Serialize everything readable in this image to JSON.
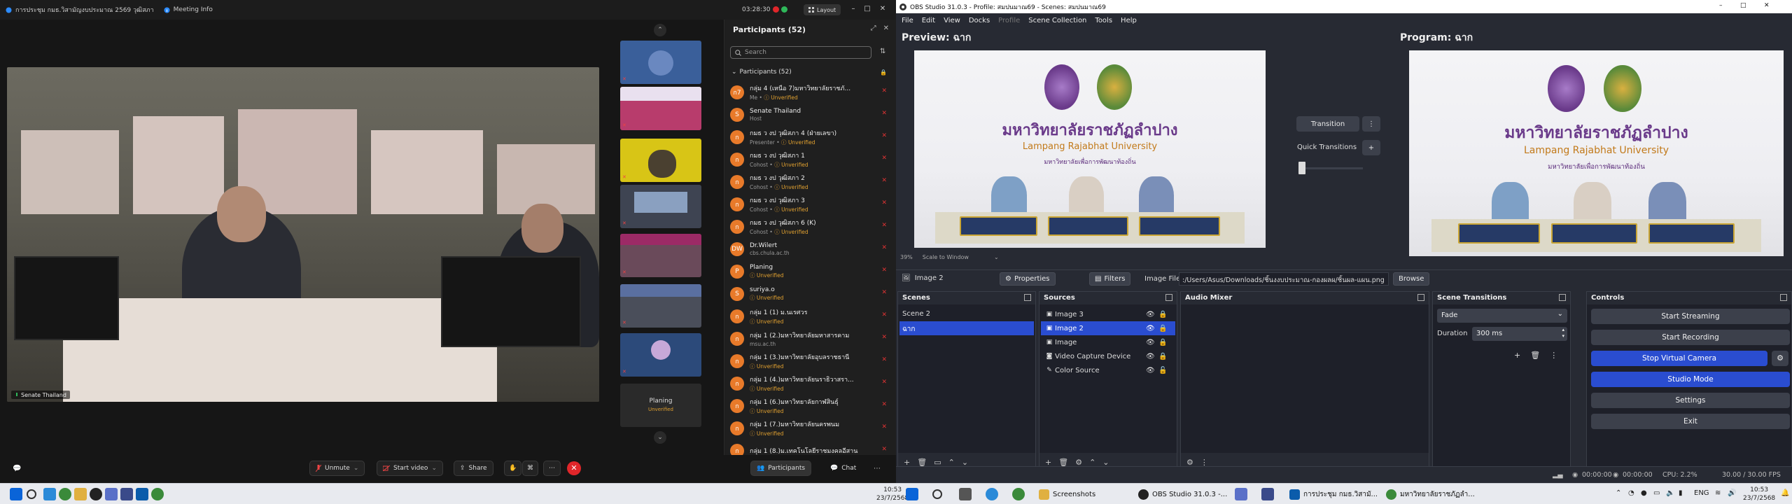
{
  "zoom": {
    "meeting_name": "การประชุม กมธ.วิสามัญงบประมาณ 2569 วุฒิสภา",
    "meeting_info_label": "Meeting Info",
    "timer": "03:28:30",
    "layout_label": "Layout",
    "speaker_name": "Senate Thailand",
    "gallery_tile_name": "Planing",
    "gallery_tile_status": "Unverified",
    "participants_panel": {
      "title": "Participants (52)",
      "search_placeholder": "Search",
      "group_label": "Participants (52)",
      "list": [
        {
          "avatar": "ก7",
          "name": "กลุ่ม 4 (เหนือ 7)มหาวิทยาลัยราชภั...",
          "role": "Me",
          "status": "Unverified"
        },
        {
          "avatar": "S",
          "name": "Senate Thailand",
          "role": "Host",
          "status": ""
        },
        {
          "avatar": "ก",
          "name": "กมธ ว งป วุฒิสภา 4 (ฝ่ายเลขา)",
          "role": "Presenter",
          "status": "Unverified"
        },
        {
          "avatar": "ก",
          "name": "กมธ ว งป วุฒิสภา 1",
          "role": "Cohost",
          "status": "Unverified"
        },
        {
          "avatar": "ก",
          "name": "กมธ ว งป วุฒิสภา 2",
          "role": "Cohost",
          "status": "Unverified"
        },
        {
          "avatar": "ก",
          "name": "กมธ ว งป วุฒิสภา 3",
          "role": "Cohost",
          "status": "Unverified"
        },
        {
          "avatar": "ก",
          "name": "กมธ ว งป วุฒิสภา 6 (K)",
          "role": "Cohost",
          "status": "Unverified"
        },
        {
          "avatar": "DW",
          "name": "Dr.Wilert",
          "role": "cbs.chula.ac.th",
          "status": ""
        },
        {
          "avatar": "P",
          "name": "Planing",
          "role": "",
          "status": "Unverified"
        },
        {
          "avatar": "S",
          "name": "suriya.o",
          "role": "",
          "status": "Unverified"
        },
        {
          "avatar": "ก",
          "name": "กลุ่ม 1 (1) ม.นเรศวร",
          "role": "",
          "status": "Unverified"
        },
        {
          "avatar": "ก",
          "name": "กลุ่ม 1 (2.)มหาวิทยาลัยมหาสารคาม",
          "role": "msu.ac.th",
          "status": ""
        },
        {
          "avatar": "ก",
          "name": "กลุ่ม 1 (3.)มหาวิทยาลัยอุบลราชธานี",
          "role": "",
          "status": "Unverified"
        },
        {
          "avatar": "ก",
          "name": "กลุ่ม 1 (4.)มหาวิทยาลัยนราธิวาสรา...",
          "role": "",
          "status": "Unverified"
        },
        {
          "avatar": "ก",
          "name": "กลุ่ม 1 (6.)มหาวิทยาลัยกาฬสินธุ์",
          "role": "",
          "status": "Unverified"
        },
        {
          "avatar": "ก",
          "name": "กลุ่ม 1 (7.)มหาวิทยาลัยนครพนม",
          "role": "",
          "status": "Unverified"
        },
        {
          "avatar": "ก",
          "name": "กลุ่ม 1 (8.)ม.เทคโนโลยีราชมงคลอีสาน",
          "role": "",
          "status": ""
        }
      ]
    },
    "toolbar": {
      "unmute": "Unmute",
      "start_video": "Start video",
      "share": "Share",
      "participants": "Participants",
      "chat": "Chat"
    }
  },
  "obs": {
    "window_title": "OBS Studio 31.0.3 - Profile: สมปนมาณ69 - Scenes: สมปนมาณ69",
    "menu": [
      "File",
      "Edit",
      "View",
      "Docks",
      "Profile",
      "Scene Collection",
      "Tools",
      "Help"
    ],
    "preview_label": "Preview: ฉาก",
    "program_label": "Program: ฉาก",
    "scene_content": {
      "university_th": "มหาวิทยาลัยราชภัฏลำปาง",
      "university_en": "Lampang Rajabhat University",
      "university_sub": "มหาวิทยาลัยเพื่อการพัฒนาท้องถิ่น"
    },
    "zoom_percent": "39%",
    "scale_mode": "Scale to Window",
    "transition_button": "Transition",
    "quick_transitions_label": "Quick Transitions",
    "selected_source": "Image 2",
    "properties_button": "Properties",
    "filters_button": "Filters",
    "image_file_label": "Image File",
    "image_file_path": ":/Users/Asus/Downloads/ชิ้นงงบประมาณ-กองผลผ/ชิ้นผล-แผน.png",
    "browse_button": "Browse",
    "docks": {
      "scenes_title": "Scenes",
      "scenes": [
        "Scene 2",
        "ฉาก"
      ],
      "sources_title": "Sources",
      "sources": [
        {
          "name": "Image 3",
          "icon": "image-icon"
        },
        {
          "name": "Image 2",
          "icon": "image-icon"
        },
        {
          "name": "Image",
          "icon": "image-icon"
        },
        {
          "name": "Video Capture Device",
          "icon": "camera-icon"
        },
        {
          "name": "Color Source",
          "icon": "brush-icon"
        }
      ],
      "audio_title": "Audio Mixer",
      "transitions_title": "Scene Transitions",
      "transition_type": "Fade",
      "duration_label": "Duration",
      "duration_value": "300 ms",
      "controls_title": "Controls",
      "controls": [
        "Start Streaming",
        "Start Recording",
        "Stop Virtual Camera",
        "Studio Mode",
        "Settings",
        "Exit"
      ]
    },
    "status": {
      "rec_time": "00:00:00",
      "stream_time": "00:00:00",
      "cpu": "CPU: 2.2%",
      "fps": "30.00 / 30.00 FPS"
    }
  },
  "taskbar": {
    "left_clock_time": "10:53",
    "left_clock_date": "23/7/2568",
    "apps": [
      "Screenshots",
      "OBS Studio 31.0.3 -...",
      "การประชุม กมธ.วิสามั...",
      "มหาวิทยาลัยราชภัฏลำ..."
    ],
    "lang": "ENG",
    "right_clock_time": "10:53",
    "right_clock_date": "23/7/2568"
  }
}
